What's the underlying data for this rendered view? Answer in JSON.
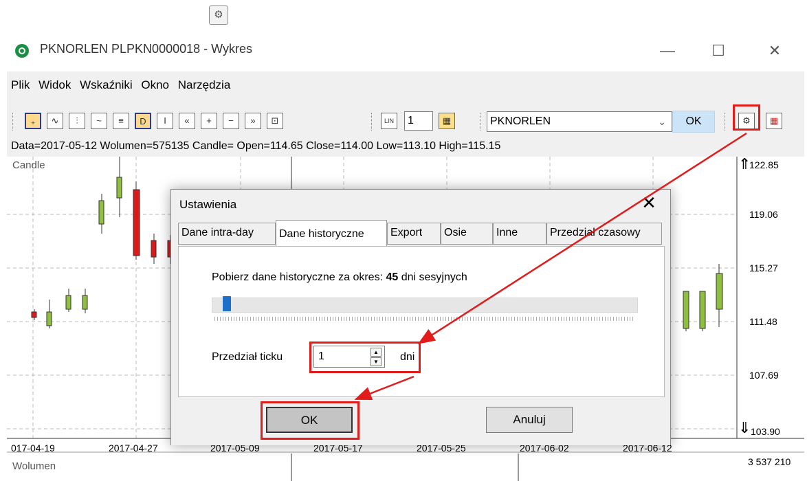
{
  "window": {
    "title": "PKNORLEN PLPKN0000018 - Wykres",
    "minimize": "—",
    "maximize": "☐",
    "close": "✕"
  },
  "menu": [
    {
      "label": "Plik"
    },
    {
      "label": "Widok"
    },
    {
      "label": "Wskaźniki"
    },
    {
      "label": "Okno"
    },
    {
      "label": "Narzędzia"
    }
  ],
  "toolbar": {
    "scale_button": "LIN",
    "interval_value": "1",
    "symbol_value": "PKNORLEN",
    "ok_label": "OK"
  },
  "infobar": "Data=2017-05-12 Wolumen=575135 Candle= Open=114.65 Close=114.00 Low=113.10 High=115.15",
  "chart": {
    "candle_legend": "Candle",
    "volume_legend": "Wolumen",
    "y_ticks": [
      "122.85",
      "119.06",
      "115.27",
      "111.48",
      "107.69",
      "103.90"
    ],
    "x_ticks": [
      "017-04-19",
      "2017-04-27",
      "2017-05-09",
      "2017-05-17",
      "2017-05-25",
      "2017-06-02",
      "2017-06-12"
    ],
    "volume_max": "3 537 210",
    "colors": {
      "up": "#8fbf3f",
      "down": "#e01818",
      "grid": "#bbbbbb"
    }
  },
  "dialog": {
    "title": "Ustawienia",
    "close": "✕",
    "tabs": [
      {
        "label": "Dane intra-day"
      },
      {
        "label": "Dane historyczne"
      },
      {
        "label": "Export"
      },
      {
        "label": "Osie"
      },
      {
        "label": "Inne"
      },
      {
        "label": "Przedział czasowy"
      }
    ],
    "history_prefix": "Pobierz dane historyczne za okres:",
    "history_days": "45",
    "history_suffix": "dni sesyjnych",
    "slider_fraction": 0.02,
    "tick_label": "Przedział ticku",
    "tick_value": "1",
    "tick_unit": "dni",
    "ok_label": "OK",
    "cancel_label": "Anuluj"
  }
}
